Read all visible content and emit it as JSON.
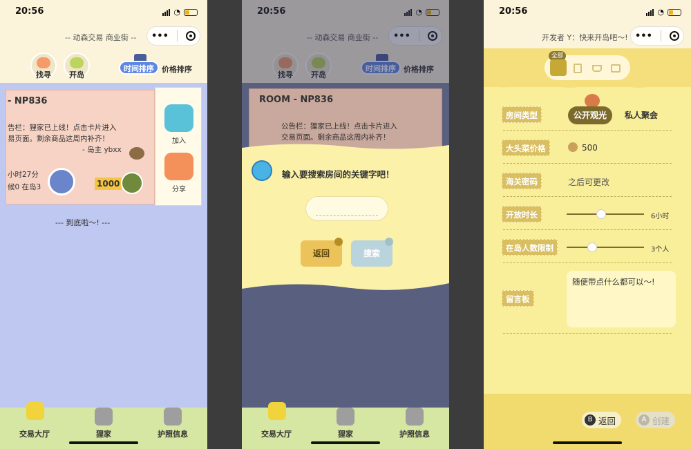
{
  "status": {
    "time": "20:56"
  },
  "screen1": {
    "nav_title": "-- 动森交易 商业街 --",
    "tabs": [
      {
        "label": "找寻"
      },
      {
        "label": "开岛"
      },
      {
        "label": "时间排序"
      },
      {
        "label": "价格排序"
      }
    ],
    "card": {
      "room": "- NP836",
      "notice_line1": "告栏：狸家已上线！点击卡片进入",
      "notice_line2": "易页面。剩余商品这周内补齐！",
      "sign": "- 岛主 ybxx",
      "time_left": "小时27分",
      "players": "候0 在岛3",
      "price": "1000",
      "join": "加入",
      "share": "分享"
    },
    "end_text": "---  到底啦～!  ---"
  },
  "screen2": {
    "nav_title": "-- 动森交易 商业街 --",
    "tabs": [
      {
        "label": "找寻"
      },
      {
        "label": "开岛"
      },
      {
        "label": "时间排序"
      },
      {
        "label": "价格排序"
      }
    ],
    "card": {
      "room": "ROOM - NP836",
      "notice_line1": "公告栏：狸家已上线！点击卡片进入",
      "notice_line2": "交易页面。剩余商品这周内补齐！"
    },
    "dialog": {
      "prompt": "输入要搜索房间的关键字吧！",
      "input_value": "",
      "back": "返回",
      "search": "搜索"
    }
  },
  "screen3": {
    "nav_title": "开发者 Y：快来开岛吧～!",
    "category_badge": "全部",
    "rows": {
      "room_type": {
        "label": "房间类型",
        "opt1": "公开观光",
        "opt2": "私人聚会"
      },
      "turnip": {
        "label": "大头菜价格",
        "value": "500"
      },
      "password": {
        "label": "海关密码",
        "value": "之后可更改"
      },
      "duration": {
        "label": "开放时长",
        "value": "6小时",
        "fraction": 0.45
      },
      "limit": {
        "label": "在岛人数限制",
        "value": "3个人",
        "fraction": 0.33
      },
      "message": {
        "label": "留言板",
        "value": "随便带点什么都可以～!"
      }
    },
    "buttons": {
      "back": "返回",
      "back_key": "B",
      "create": "创建",
      "create_key": "A"
    }
  },
  "bottom_nav": [
    {
      "label": "交易大厅"
    },
    {
      "label": "狸家"
    },
    {
      "label": "护照信息"
    }
  ],
  "colors": {
    "accent_blue": "#5d87e3",
    "sand": "#fbf3da",
    "yellow": "#f9ee9a",
    "label_gold": "#d9bf62"
  }
}
